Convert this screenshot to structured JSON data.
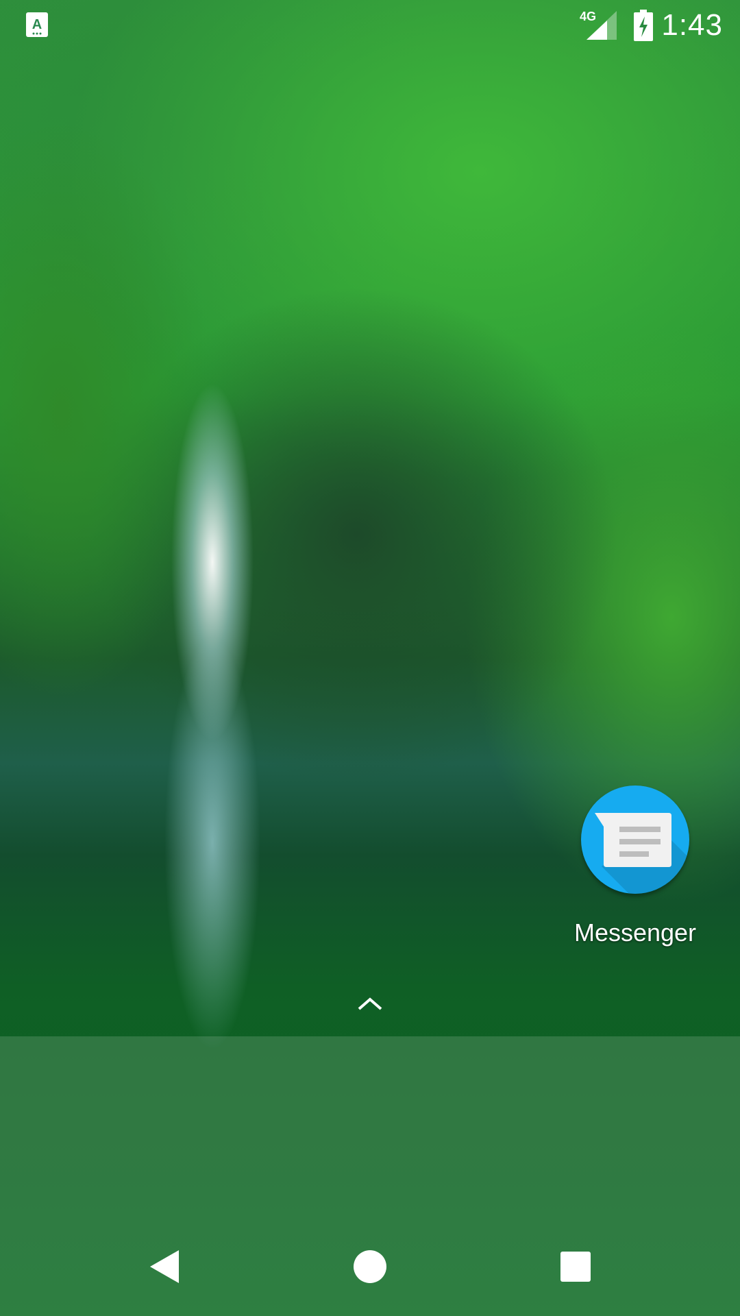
{
  "status_bar": {
    "time": "1:43",
    "network": "4G",
    "notification_icon": "a-notification-icon",
    "signal_icon": "signal-icon",
    "battery_icon": "battery-charging-icon"
  },
  "home": {
    "apps": [
      {
        "label": "Messenger",
        "icon": "messages-icon",
        "color": "#16abf0"
      }
    ],
    "drawer_handle": "chevron-up-icon"
  },
  "nav_bar": {
    "back": "back-icon",
    "home": "home-icon",
    "recents": "recents-icon"
  }
}
